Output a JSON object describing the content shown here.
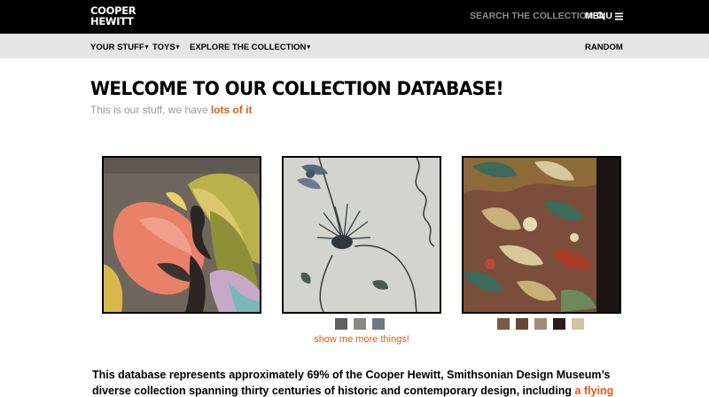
{
  "header": {
    "logo_line1": "COOPER",
    "logo_line2": "HEWITT",
    "search_label": "SEARCH THE COLLECTION",
    "search_icon": "search-icon",
    "menu_label": "MENU",
    "menu_icon": "hamburger-icon"
  },
  "nav": {
    "items": [
      {
        "label": "YOUR STUFF",
        "caret": "▾"
      },
      {
        "label": "TOYS",
        "caret": "▾"
      },
      {
        "label": "EXPLORE THE COLLECTION",
        "caret": "▾"
      }
    ],
    "random_label": "RANDOM"
  },
  "main": {
    "title": "WELCOME TO OUR COLLECTION DATABASE!",
    "subtitle_prefix": "This is our stuff, we have ",
    "subtitle_link": "lots of it",
    "more_link": "show me more things!",
    "description_text": "This database represents approximately 69% of the Cooper Hewitt, Smithsonian Design Museum’s diverse collection spanning thirty centuries of historic and contemporary design, including ",
    "description_link": "a flying"
  },
  "cards": [
    {
      "name": "painting-abstract-leaves",
      "swatches": []
    },
    {
      "name": "textile-floral-print",
      "swatches": [
        "#5d5f63",
        "#878784",
        "#6b7a80"
      ]
    },
    {
      "name": "textile-brocade",
      "swatches": [
        "#7a5a44",
        "#6b4636",
        "#a38b72",
        "#2e1a1c",
        "#d2c6a2"
      ]
    }
  ],
  "colors": {
    "accent": "#e05a1c",
    "topbar": "#000000",
    "navbar": "#e5e5e5",
    "muted_text": "#9a9a9a"
  }
}
